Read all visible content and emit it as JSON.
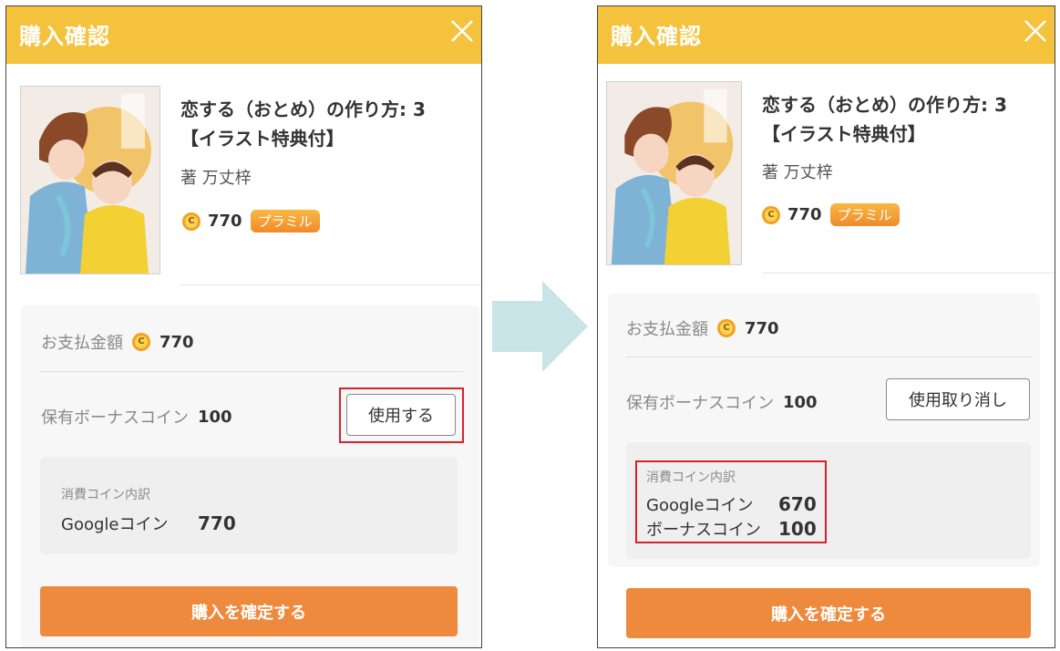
{
  "colors": {
    "header": "#f5c23d",
    "confirm_button": "#ee8a3d",
    "highlight": "#d9212c",
    "badge": "#f39a34",
    "arrow": "#c9e4e6"
  },
  "before": {
    "header": {
      "title": "購入確認",
      "close_icon": "close-icon"
    },
    "book": {
      "title_line1": "恋する（おとめ）の作り方: 3",
      "title_line2": "【イラスト特典付】",
      "author": "著 万丈梓",
      "coin_icon": "coin-icon",
      "price": "770",
      "badge": "プラミル"
    },
    "payment": {
      "label": "お支払金額",
      "amount": "770"
    },
    "bonus": {
      "label": "保有ボーナスコイン",
      "amount": "100",
      "button": "使用する"
    },
    "breakdown": {
      "caption": "消費コイン内訳",
      "rows": [
        {
          "label": "Googleコイン",
          "value": "770"
        }
      ]
    },
    "confirm": "購入を確定する"
  },
  "after": {
    "header": {
      "title": "購入確認",
      "close_icon": "close-icon"
    },
    "book": {
      "title_line1": "恋する（おとめ）の作り方: 3",
      "title_line2": "【イラスト特典付】",
      "author": "著 万丈梓",
      "coin_icon": "coin-icon",
      "price": "770",
      "badge": "プラミル"
    },
    "payment": {
      "label": "お支払金額",
      "amount": "770"
    },
    "bonus": {
      "label": "保有ボーナスコイン",
      "amount": "100",
      "button": "使用取り消し"
    },
    "breakdown": {
      "caption": "消費コイン内訳",
      "rows": [
        {
          "label": "Googleコイン",
          "value": "670"
        },
        {
          "label": "ボーナスコイン",
          "value": "100"
        }
      ]
    },
    "confirm": "購入を確定する"
  }
}
